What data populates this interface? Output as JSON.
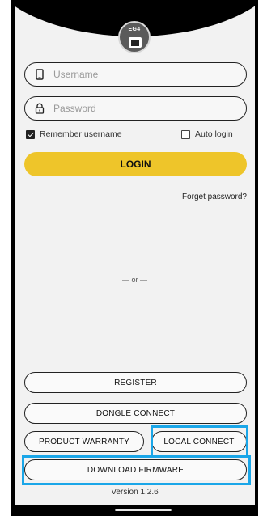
{
  "logo": {
    "text": "EG4"
  },
  "login": {
    "username_placeholder": "Username",
    "password_placeholder": "Password",
    "remember_label": "Remember username",
    "remember_checked": true,
    "auto_login_label": "Auto login",
    "auto_login_checked": false,
    "login_label": "LOGIN",
    "forgot_label": "Forget password?"
  },
  "divider_text": "— or —",
  "actions": {
    "register": "REGISTER",
    "dongle_connect": "DONGLE CONNECT",
    "product_warranty": "PRODUCT WARRANTY",
    "local_connect": "LOCAL CONNECT",
    "download_firmware": "DOWNLOAD FIRMWARE"
  },
  "version": "Version 1.2.6",
  "colors": {
    "accent": "#eec52a",
    "highlight": "#1aa6e8"
  }
}
